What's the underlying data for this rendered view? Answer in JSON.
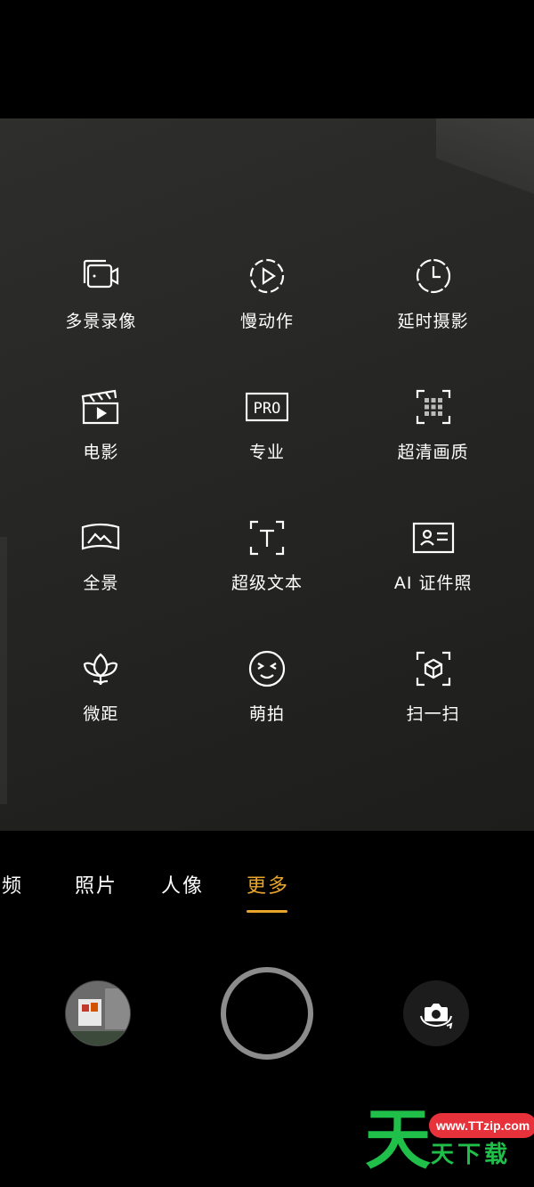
{
  "modes": [
    {
      "label": "多景录像",
      "icon": "multi-scene-video-icon"
    },
    {
      "label": "慢动作",
      "icon": "slow-motion-icon"
    },
    {
      "label": "延时摄影",
      "icon": "time-lapse-icon"
    },
    {
      "label": "电影",
      "icon": "movie-clapper-icon"
    },
    {
      "label": "专业",
      "icon": "pro-mode-icon",
      "icon_text": "PRO"
    },
    {
      "label": "超清画质",
      "icon": "ultra-hd-icon"
    },
    {
      "label": "全景",
      "icon": "panorama-icon"
    },
    {
      "label": "超级文本",
      "icon": "super-text-icon"
    },
    {
      "label": "AI 证件照",
      "icon": "id-photo-icon"
    },
    {
      "label": "微距",
      "icon": "macro-flower-icon"
    },
    {
      "label": "萌拍",
      "icon": "cute-face-icon"
    },
    {
      "label": "扫一扫",
      "icon": "scan-icon"
    }
  ],
  "tabs": [
    {
      "label": "视频"
    },
    {
      "label": "照片"
    },
    {
      "label": "人像"
    },
    {
      "label": "更多",
      "active": true
    }
  ],
  "controls": {
    "gallery": "gallery-thumbnail",
    "shutter": "shutter-button",
    "switch": "switch-camera-icon"
  },
  "colors": {
    "accent": "#e9a52b",
    "watermark_green": "#1fbf4a",
    "watermark_red": "#e8323b"
  },
  "watermark": {
    "big_char": "天",
    "url": "www.TTzip.com",
    "name": "天下载"
  }
}
